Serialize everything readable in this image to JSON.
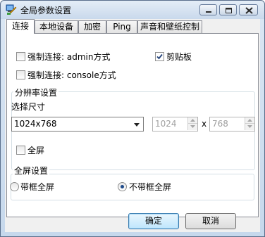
{
  "window": {
    "title": "全局参数设置"
  },
  "tabs": [
    {
      "label": "连接",
      "active": true
    },
    {
      "label": "本地设备",
      "active": false
    },
    {
      "label": "加密",
      "active": false
    },
    {
      "label": "Ping",
      "active": false
    },
    {
      "label": "声音和壁纸控制",
      "active": false
    }
  ],
  "connection": {
    "force_admin": {
      "label": "强制连接: admin方式",
      "checked": false
    },
    "clipboard": {
      "label": "剪贴板",
      "checked": true
    },
    "force_console": {
      "label": "强制连接: console方式",
      "checked": false
    }
  },
  "resolution": {
    "group_title": "分辨率设置",
    "select_label": "选择尺寸",
    "selected_size": "1024x768",
    "width_value": "1024",
    "separator": "x",
    "height_value": "768",
    "fullscreen": {
      "label": "全屏",
      "checked": false
    }
  },
  "fullscreen_settings": {
    "group_title": "全屏设置",
    "options": [
      {
        "label": "带框全屏",
        "selected": false
      },
      {
        "label": "不带框全屏",
        "selected": true
      }
    ]
  },
  "buttons": {
    "ok_label": "确定",
    "cancel_label": "取消"
  },
  "colors": {
    "title_gradient_top": "#e4edf7",
    "panel_bg": "#ffffff",
    "dialog_bg": "#f0f0f0",
    "default_button": "#bee6fd"
  }
}
